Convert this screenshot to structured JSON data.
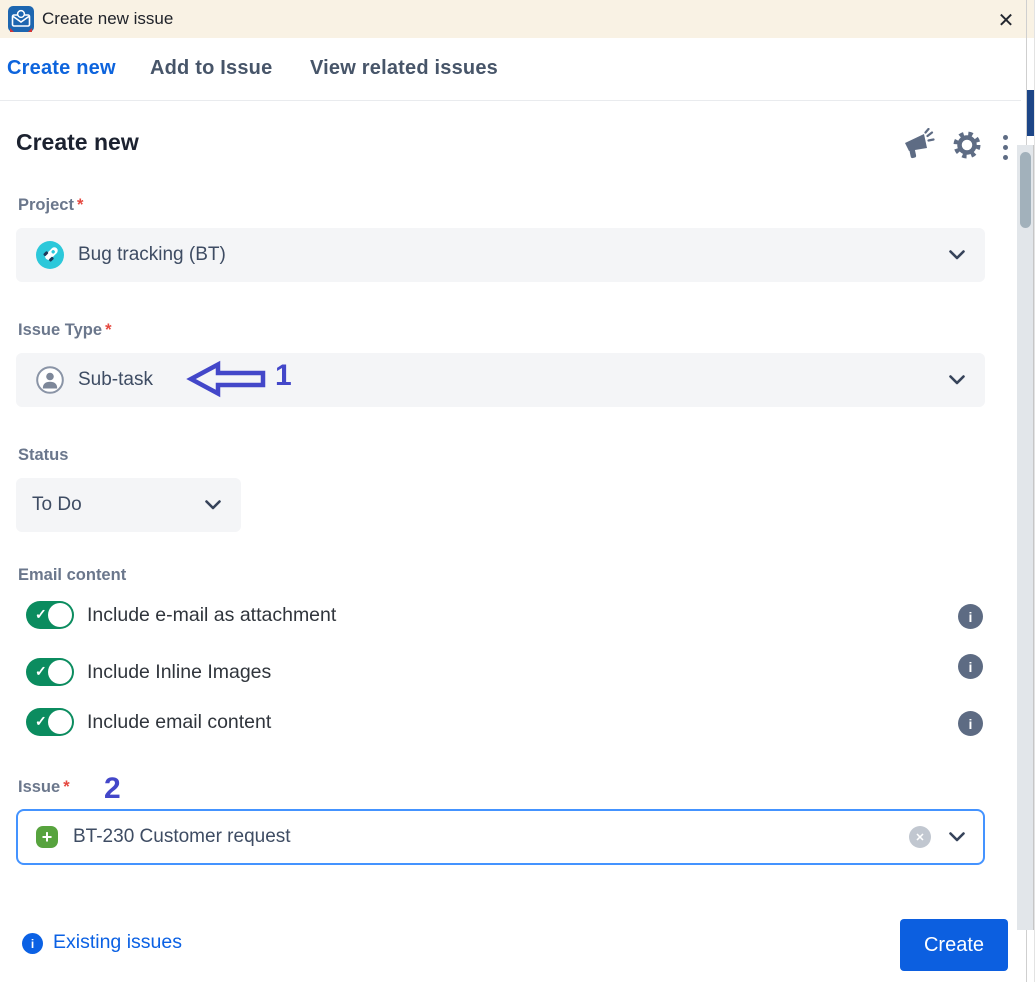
{
  "colors": {
    "titlebar_bg": "#F9F2E4",
    "active_tab_blue": "#0D64DD",
    "inactive_tab": "#475569",
    "label_gray": "#6B778C",
    "required_asterisk": "#E5483F",
    "field_bg": "#F4F5F7",
    "field_text": "#3E4C63",
    "toggle_on_green": "#0B8C5F",
    "info_icon_gray": "#5D6B83",
    "annotation_indigo": "#4347C9",
    "focus_border_blue": "#4493FF",
    "link_blue": "#0B61E4",
    "primary_button_blue": "#0C5FE0",
    "scrollbar_thumb": "#A2B1BB",
    "edge_accent_navy": "#1C4587",
    "plus_icon_green": "#57A33E"
  },
  "titlebar": {
    "title": "Create new issue",
    "app_icon": "jira-mail-addin-icon",
    "close_glyph": "✕"
  },
  "tabs": [
    {
      "label": "Create new",
      "active": true
    },
    {
      "label": "Add to Issue",
      "active": false
    },
    {
      "label": "View related issues",
      "active": false
    }
  ],
  "panel": {
    "title": "Create new",
    "toolbar_icons": [
      "announcement-icon",
      "settings-gear-icon",
      "more-vertical-icon"
    ]
  },
  "form": {
    "project": {
      "label": "Project",
      "required": "*",
      "value": "Bug tracking (BT)",
      "icon": "project-avatar-rocket"
    },
    "issue_type": {
      "label": "Issue Type",
      "required": "*",
      "value": "Sub-task",
      "icon": "subtask-person-icon",
      "annotation": "1"
    },
    "status": {
      "label": "Status",
      "value": "To Do"
    },
    "email_content": {
      "label": "Email content",
      "toggles": [
        {
          "label": "Include e-mail as attachment",
          "on": true
        },
        {
          "label": "Include Inline Images",
          "on": true
        },
        {
          "label": "Include email content",
          "on": true
        }
      ]
    },
    "issue": {
      "label": "Issue",
      "required": "*",
      "annotation": "2",
      "value": "BT-230 Customer request",
      "icon": "add-issue-plus-icon"
    }
  },
  "footer": {
    "existing_issues_label": "Existing issues",
    "create_label": "Create"
  },
  "glyphs": {
    "check": "✓",
    "plus": "+",
    "info": "i",
    "clear": "✕"
  }
}
